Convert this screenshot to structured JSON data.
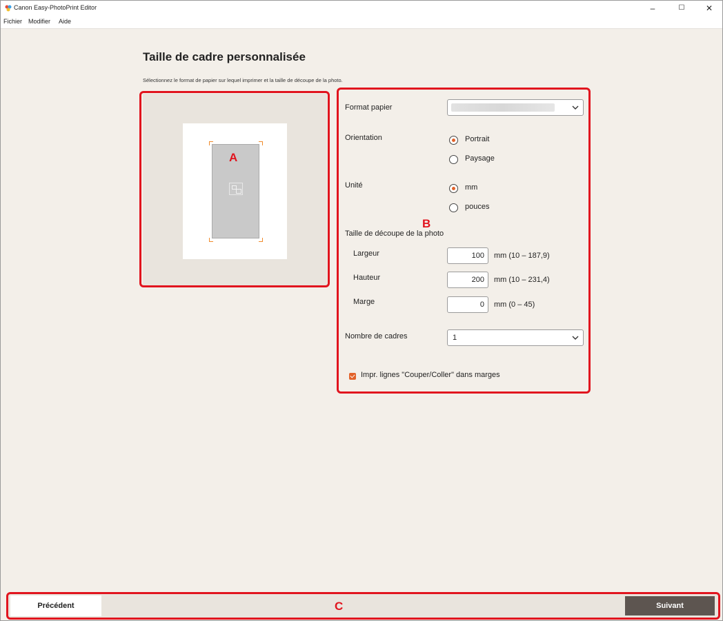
{
  "window": {
    "title": "Canon Easy-PhotoPrint Editor",
    "minimize_glyph": "–",
    "maximize_glyph": "☐",
    "close_glyph": "✕"
  },
  "menu": [
    "Fichier",
    "Modifier",
    "Aide"
  ],
  "page": {
    "title": "Taille de cadre personnalisée",
    "subtitle": "Sélectionnez le format de papier sur lequel imprimer et la taille de découpe de la photo."
  },
  "callouts": {
    "a": "A",
    "b": "B",
    "c": "C"
  },
  "settings": {
    "paper_format": {
      "label": "Format papier",
      "value": ""
    },
    "orientation": {
      "label": "Orientation",
      "options": [
        "Portrait",
        "Paysage"
      ],
      "selected": "Portrait"
    },
    "unit": {
      "label": "Unité",
      "options": [
        "mm",
        "pouces"
      ],
      "selected": "mm"
    },
    "crop_size": {
      "label": "Taille de découpe de la photo",
      "width": {
        "label": "Largeur",
        "value": "100",
        "range": "mm (10 – 187,9)"
      },
      "height": {
        "label": "Hauteur",
        "value": "200",
        "range": "mm (10 – 231,4)"
      },
      "margin": {
        "label": "Marge",
        "value": "0",
        "range": "mm (0 – 45)"
      }
    },
    "frame_count": {
      "label": "Nombre de cadres",
      "value": "1"
    },
    "print_cut_lines": {
      "label": "Impr. lignes \"Couper/Coller\" dans marges",
      "checked": true
    }
  },
  "footer": {
    "previous": "Précédent",
    "next": "Suivant"
  },
  "colors": {
    "accent_orange": "#e2622a",
    "callout_red": "#e1141e",
    "next_button": "#5d5550"
  },
  "icons": [
    "app-icon",
    "chevron-down-icon",
    "photo-placeholder-icon"
  ]
}
